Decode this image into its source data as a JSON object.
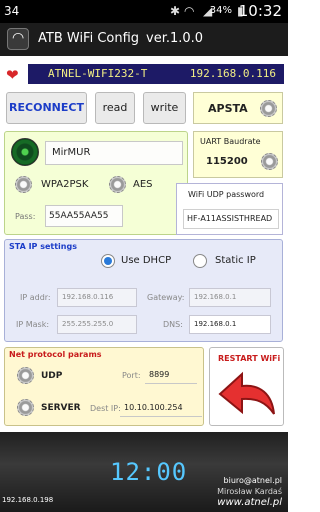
{
  "status_bar": {
    "left_text": "34",
    "battery_pct": "34%",
    "time": "10:32",
    "icons": [
      "bluetooth-icon",
      "wifi-icon",
      "signal-icon",
      "battery-icon"
    ]
  },
  "app_bar": {
    "title": "ATB WiFi Config",
    "version": "ver.1.0.0",
    "icon": "wifi-icon"
  },
  "network_bar": {
    "ssid": "ATNEL-WIFI232-T",
    "ip": "192.168.0.116",
    "icon": "heart-icon"
  },
  "toolbar": {
    "reconnect": "RECONNECT",
    "read": "read",
    "write": "write"
  },
  "mode": {
    "label": "APSTA"
  },
  "wifi": {
    "ssid": "MirMUR",
    "security": "WPA2PSK",
    "encryption": "AES",
    "pass_label": "Pass:",
    "pass_value": "55AA55AA55"
  },
  "uart": {
    "label": "UART Baudrate",
    "value": "115200"
  },
  "udp_password": {
    "label": "WiFi UDP password",
    "value": "HF-A11ASSISTHREAD"
  },
  "sta_ip": {
    "header": "STA IP settings",
    "option_dhcp": "Use DHCP",
    "option_static": "Static IP",
    "selected": "Use DHCP",
    "ip_label": "IP addr:",
    "ip_value": "192.168.0.116",
    "gateway_label": "Gateway:",
    "gateway_value": "192.168.0.1",
    "mask_label": "IP Mask:",
    "mask_value": "255.255.255.0",
    "dns_label": "DNS:",
    "dns_value": "192.168.0.1"
  },
  "net_protocol": {
    "header": "Net protocol params",
    "protocol": "UDP",
    "port_label": "Port:",
    "port_value": "8899",
    "mode": "SERVER",
    "dest_ip_label": "Dest IP:",
    "dest_ip_value": "10.10.100.254"
  },
  "restart": {
    "label": "RESTART WiFi",
    "icon": "back-arrow-icon"
  },
  "footer": {
    "clock": "12:00",
    "device_ip": "192.168.0.198",
    "email": "biuro@atnel.pl",
    "author": "Mirosław Kardaś",
    "website": "www.atnel.pl"
  },
  "colors": {
    "ssid_bg": "#1d1a66",
    "ssid_text": "#f2ef85",
    "accent_blue": "#1c3dc8",
    "accent_red": "#c81c1c"
  }
}
